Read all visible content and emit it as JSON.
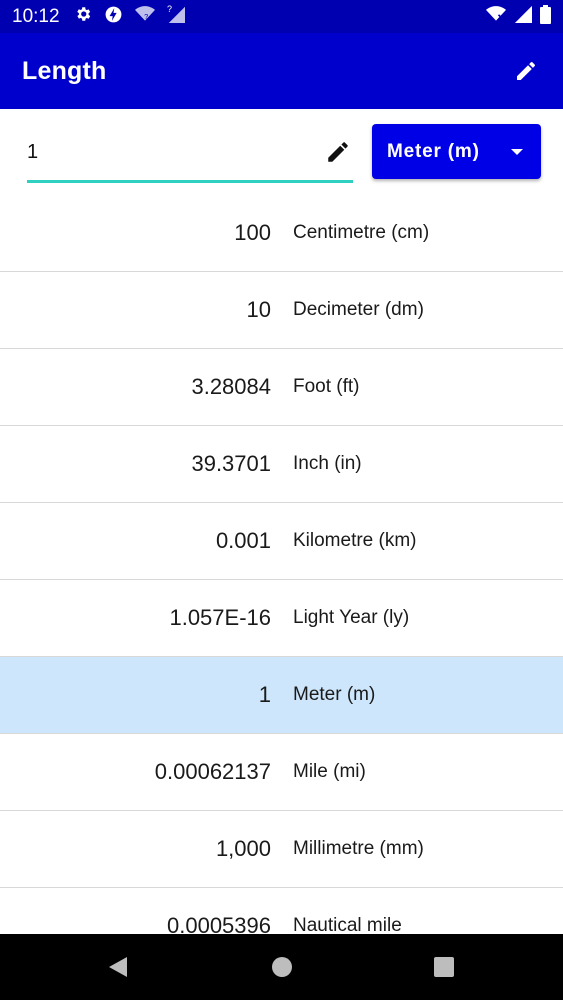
{
  "status_bar": {
    "time": "10:12",
    "left_icons": [
      "gear-icon",
      "bolt-icon",
      "wifi-question-icon",
      "signal-question-icon"
    ],
    "right_icons": [
      "wifi-x-icon",
      "signal-icon",
      "battery-icon"
    ]
  },
  "app_bar": {
    "title": "Length",
    "action_icon": "pencil-icon"
  },
  "input": {
    "value": "1",
    "edit_icon": "pencil-icon"
  },
  "unit_selector": {
    "selected": "Meter (m)",
    "icon": "dropdown-arrow-icon"
  },
  "conversions": [
    {
      "value": "100",
      "unit": "Centimetre (cm)",
      "selected": false
    },
    {
      "value": "10",
      "unit": "Decimeter (dm)",
      "selected": false
    },
    {
      "value": "3.28084",
      "unit": "Foot (ft)",
      "selected": false
    },
    {
      "value": "39.3701",
      "unit": "Inch (in)",
      "selected": false
    },
    {
      "value": "0.001",
      "unit": "Kilometre (km)",
      "selected": false
    },
    {
      "value": "1.057E-16",
      "unit": "Light Year (ly)",
      "selected": false
    },
    {
      "value": "1",
      "unit": "Meter (m)",
      "selected": true
    },
    {
      "value": "0.00062137",
      "unit": "Mile (mi)",
      "selected": false
    },
    {
      "value": "1,000",
      "unit": "Millimetre (mm)",
      "selected": false
    },
    {
      "value": "0.0005396",
      "unit": "Nautical mile",
      "selected": false
    }
  ],
  "colors": {
    "status_bar": "#0000b0",
    "app_bar": "#0000cc",
    "selector": "#0000e6",
    "field_underline": "#2fd0c2",
    "selected_row": "#cde6fb"
  },
  "nav_bar": {
    "buttons": [
      "back-icon",
      "home-icon",
      "recents-icon"
    ]
  }
}
